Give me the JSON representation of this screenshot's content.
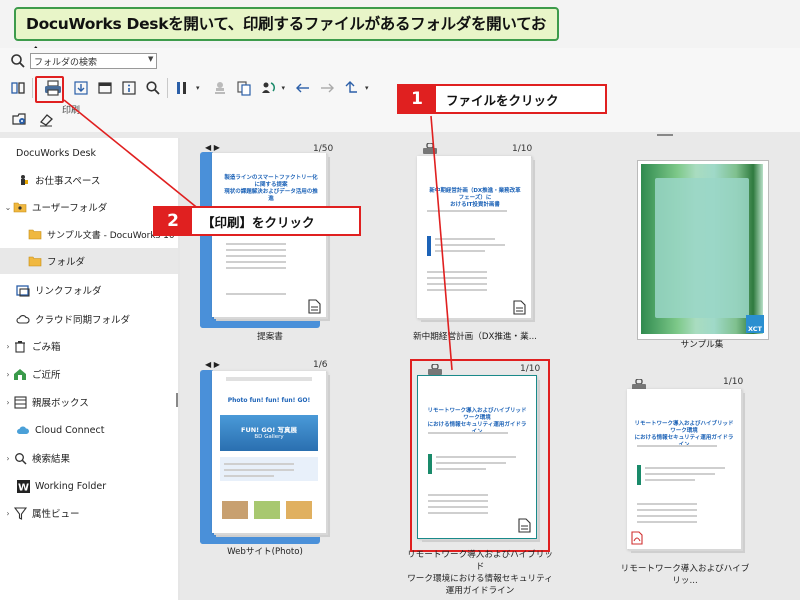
{
  "banner": {
    "text": "DocuWorks Deskを開いて、印刷するファイルがあるフォルダを開いておく"
  },
  "search": {
    "placeholder": "フォルダの検索"
  },
  "toolbar": {
    "print_tooltip": "印刷"
  },
  "callouts": {
    "step1": {
      "number": "1",
      "text": "ファイルをクリック"
    },
    "step2": {
      "number": "2",
      "text": "【印刷】をクリック"
    }
  },
  "sidebar": {
    "items": [
      {
        "label": "DocuWorks Desk",
        "icon": "none"
      },
      {
        "label": "お仕事スペース",
        "icon": "worker-icon"
      },
      {
        "label": "ユーザーフォルダ",
        "icon": "folder-icon"
      },
      {
        "label": "サンプル文書 - DocuWorks 10",
        "icon": "folder-icon"
      },
      {
        "label": "フォルダ",
        "icon": "folder-icon"
      },
      {
        "label": "リンクフォルダ",
        "icon": "link-folder-icon"
      },
      {
        "label": "クラウド同期フォルダ",
        "icon": "cloud-icon"
      },
      {
        "label": "ごみ箱",
        "icon": "trash-icon"
      },
      {
        "label": "ご近所",
        "icon": "neighbors-icon"
      },
      {
        "label": "親展ボックス",
        "icon": "confidential-box-icon"
      },
      {
        "label": "Cloud Connect",
        "icon": "cloud-connect-icon"
      },
      {
        "label": "検索結果",
        "icon": "search-icon"
      },
      {
        "label": "Working Folder",
        "icon": "w-icon"
      },
      {
        "label": "属性ビュー",
        "icon": "filter-icon"
      }
    ]
  },
  "files": [
    {
      "caption": "提案書",
      "pages": "1/50",
      "doc_title": "製造ラインのスマートファクトリー化に関する提案\n現状の課題解決およびデータ活用の推進"
    },
    {
      "caption": "新中期経営計画（DX推進・業...",
      "pages": "1/10",
      "doc_title": "新中期経営計画（DX推進・業務改革フェーズ）に\nおけるIT投資計画書"
    },
    {
      "caption": "サンプル集",
      "pages": "",
      "doc_title": ""
    },
    {
      "caption": "Webサイト(Photo)",
      "pages": "1/6",
      "doc_title": "Photo fun! fun! fun! GO!",
      "banner_text": "FUN! GO! 写真展",
      "banner_sub": "BD Gallery"
    },
    {
      "caption": "リモートワーク導入およびハイブリッド\nワーク環境における情報セキュリティ\n運用ガイドライン",
      "pages": "1/10",
      "doc_title": "リモートワーク導入およびハイブリッドワーク環境\nにおける情報セキュリティ運用ガイドライン"
    },
    {
      "caption": "リモートワーク導入およびハイブリッ...",
      "pages": "1/10",
      "doc_title": "リモートワーク導入およびハイブリッドワーク環境\nにおける情報セキュリティ運用ガイドライン"
    }
  ],
  "colors": {
    "accent_red": "#e02020",
    "banner_bg": "#e8f5c8",
    "banner_border": "#3d9b4b",
    "doc_blue": "#1d63b7"
  }
}
